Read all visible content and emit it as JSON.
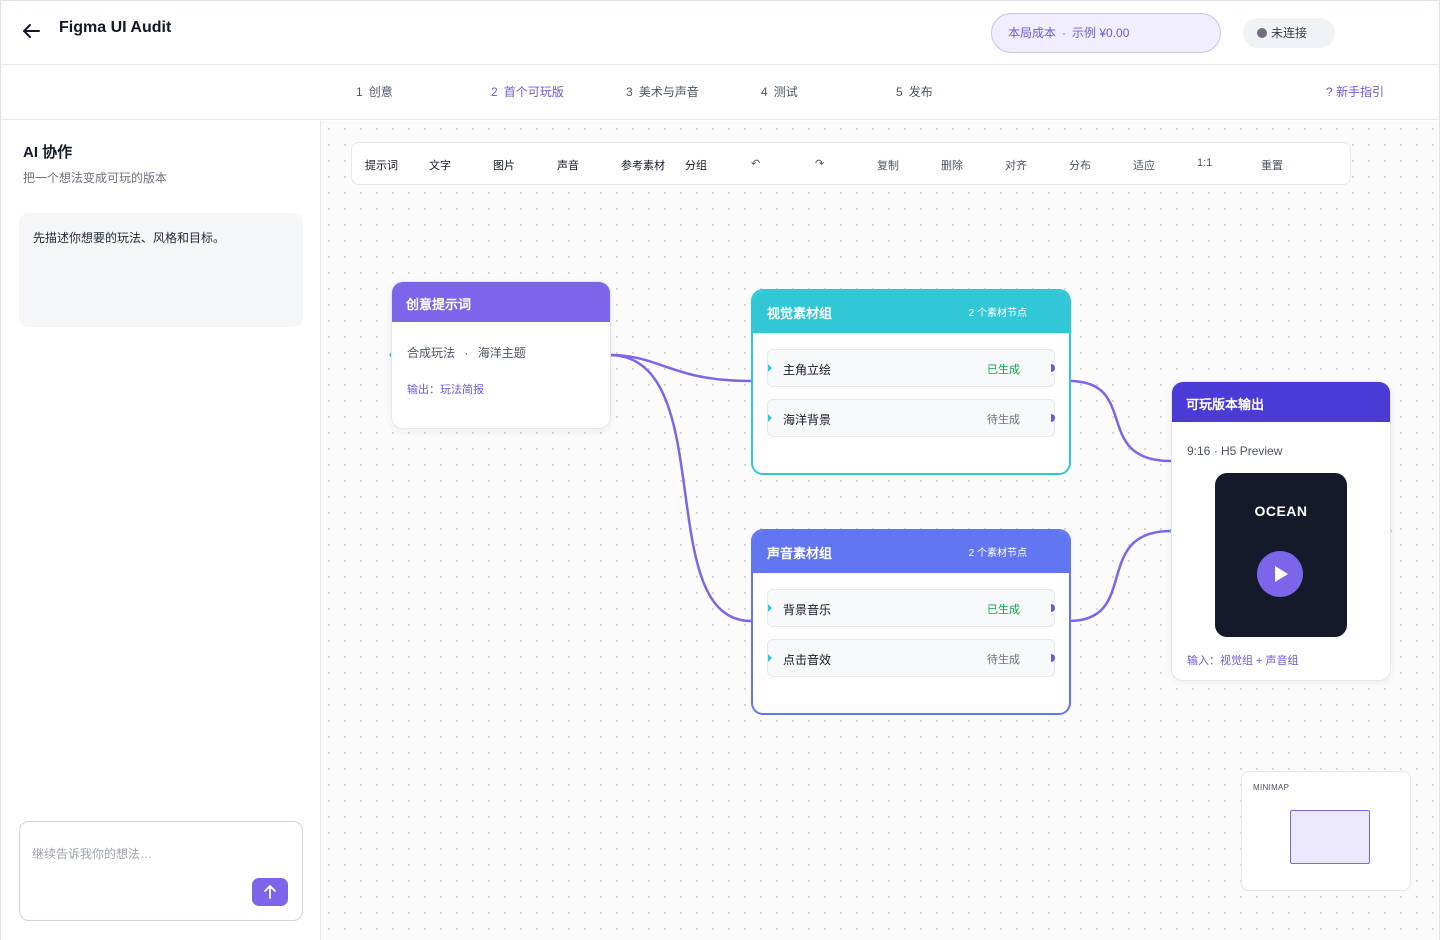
{
  "header": {
    "title": "Figma UI Audit",
    "cost_label": "本局成本",
    "cost_separator": "·",
    "cost_value": "示例 ¥0.00",
    "connection_status": "未连接"
  },
  "steps": {
    "items": [
      {
        "num": "1",
        "label": "创意"
      },
      {
        "num": "2",
        "label": "首个可玩版"
      },
      {
        "num": "3",
        "label": "美术与声音"
      },
      {
        "num": "4",
        "label": "测试"
      },
      {
        "num": "5",
        "label": "发布"
      }
    ],
    "active_index": 1,
    "guide": "? 新手指引"
  },
  "sidebar": {
    "title": "AI 协作",
    "subtitle": "把一个想法变成可玩的版本",
    "message": "先描述你想要的玩法、风格和目标。",
    "input_placeholder": "继续告诉我你的想法…"
  },
  "toolbar": {
    "items": [
      "提示词",
      "文字",
      "图片",
      "声音",
      "参考素材",
      "分组",
      "↶",
      "↷",
      "复制",
      "删除",
      "对齐",
      "分布",
      "适应",
      "1:1",
      "重置"
    ]
  },
  "nodes": {
    "prompt": {
      "title": "创意提示词",
      "content_a": "合成玩法",
      "content_sep": "·",
      "content_b": "海洋主题",
      "output": "输出：玩法简报"
    },
    "visual": {
      "title": "视觉素材组",
      "count": "2 个素材节点",
      "items": [
        {
          "name": "主角立绘",
          "status": "已生成"
        },
        {
          "name": "海洋背景",
          "status": "待生成"
        }
      ]
    },
    "audio": {
      "title": "声音素材组",
      "count": "2 个素材节点",
      "items": [
        {
          "name": "背景音乐",
          "status": "已生成"
        },
        {
          "name": "点击音效",
          "status": "待生成"
        }
      ]
    },
    "output": {
      "title": "可玩版本输出",
      "subtitle": "9:16 · H5 Preview",
      "preview_title": "OCEAN",
      "input": "输入：视觉组 + 声音组"
    }
  },
  "minimap": {
    "label": "MINIMAP"
  },
  "colors": {
    "accent": "#7c65e9",
    "visual": "#31c7d5",
    "audio": "#6376f2",
    "output": "#4a3bd6",
    "done": "#16a34a"
  }
}
